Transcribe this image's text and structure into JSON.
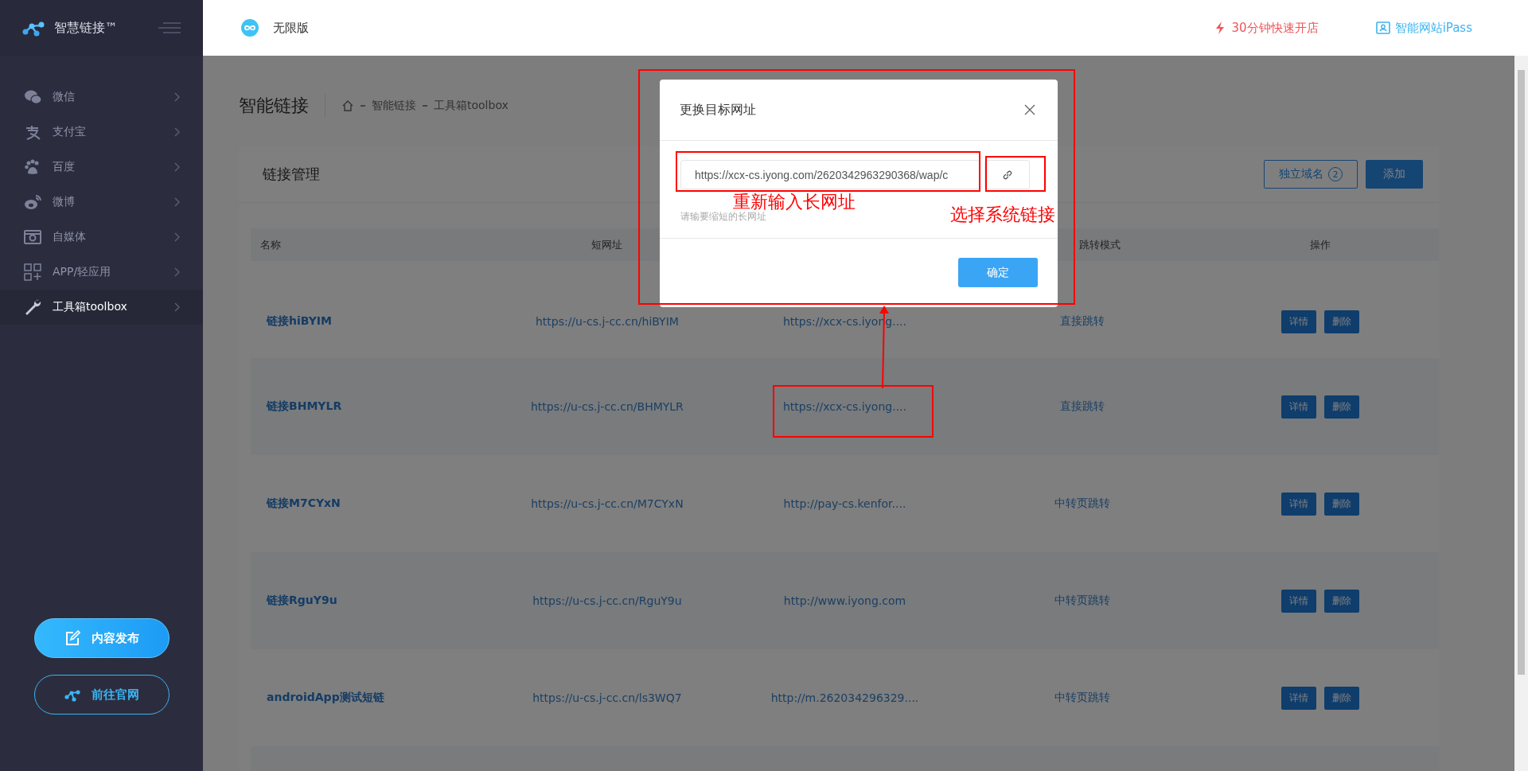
{
  "sidebar": {
    "brand": "智慧链接™",
    "items": [
      {
        "label": "微信",
        "selected": false
      },
      {
        "label": "支付宝",
        "selected": false
      },
      {
        "label": "百度",
        "selected": false
      },
      {
        "label": "微博",
        "selected": false
      },
      {
        "label": "自媒体",
        "selected": false
      },
      {
        "label": "APP/轻应用",
        "selected": false
      },
      {
        "label": "工具箱toolbox",
        "selected": true
      }
    ],
    "buttons": [
      {
        "label": "内容发布",
        "kind": "filled"
      },
      {
        "label": "前往官网",
        "kind": "outline"
      }
    ]
  },
  "header": {
    "edition": "无限版",
    "links": [
      {
        "label": "30分钟快速开店",
        "kind": "promo"
      },
      {
        "label": "智能网站iPass",
        "kind": "site"
      }
    ]
  },
  "page": {
    "title": "智能链接",
    "breadcrumb": [
      "智能链接",
      "工具箱toolbox"
    ]
  },
  "card": {
    "title": "链接管理",
    "buttons": [
      {
        "label": "独立域名",
        "badge": "2",
        "kind": "outline"
      },
      {
        "label": "添加",
        "kind": "primary"
      }
    ]
  },
  "table": {
    "columns": [
      "名称",
      "短网址",
      "跳转模式",
      "操作"
    ],
    "rows": [
      {
        "name": "链接hiBYIM",
        "short_url": "https://u-cs.j-cc.cn/hiBYIM",
        "long_url": "https://xcx-cs.iyong....",
        "mode": "直接跳转",
        "actions": [
          "详情",
          "删除"
        ]
      },
      {
        "name": "链接BHMYLR",
        "short_url": "https://u-cs.j-cc.cn/BHMYLR",
        "long_url": "https://xcx-cs.iyong....",
        "mode": "直接跳转",
        "actions": [
          "详情",
          "删除"
        ]
      },
      {
        "name": "链接M7CYxN",
        "short_url": "https://u-cs.j-cc.cn/M7CYxN",
        "long_url": "http://pay-cs.kenfor....",
        "mode": "中转页跳转",
        "actions": [
          "详情",
          "删除"
        ]
      },
      {
        "name": "链接RguY9u",
        "short_url": "https://u-cs.j-cc.cn/RguY9u",
        "long_url": "http://www.iyong.com",
        "mode": "中转页跳转",
        "actions": [
          "详情",
          "删除"
        ]
      },
      {
        "name": "androidApp测试短链",
        "short_url": "https://u-cs.j-cc.cn/ls3WQ7",
        "long_url": "http://m.262034296329....",
        "mode": "中转页跳转",
        "actions": [
          "详情",
          "删除"
        ]
      }
    ]
  },
  "modal": {
    "title": "更换目标网址",
    "value": "https://xcx-cs.iyong.com/2620342963290368/wap/c",
    "hint": "请输要缩短的长网址",
    "confirm": "确定"
  },
  "annotations": [
    {
      "text": "重新输入长网址"
    },
    {
      "text": "选择系统链接"
    }
  ]
}
